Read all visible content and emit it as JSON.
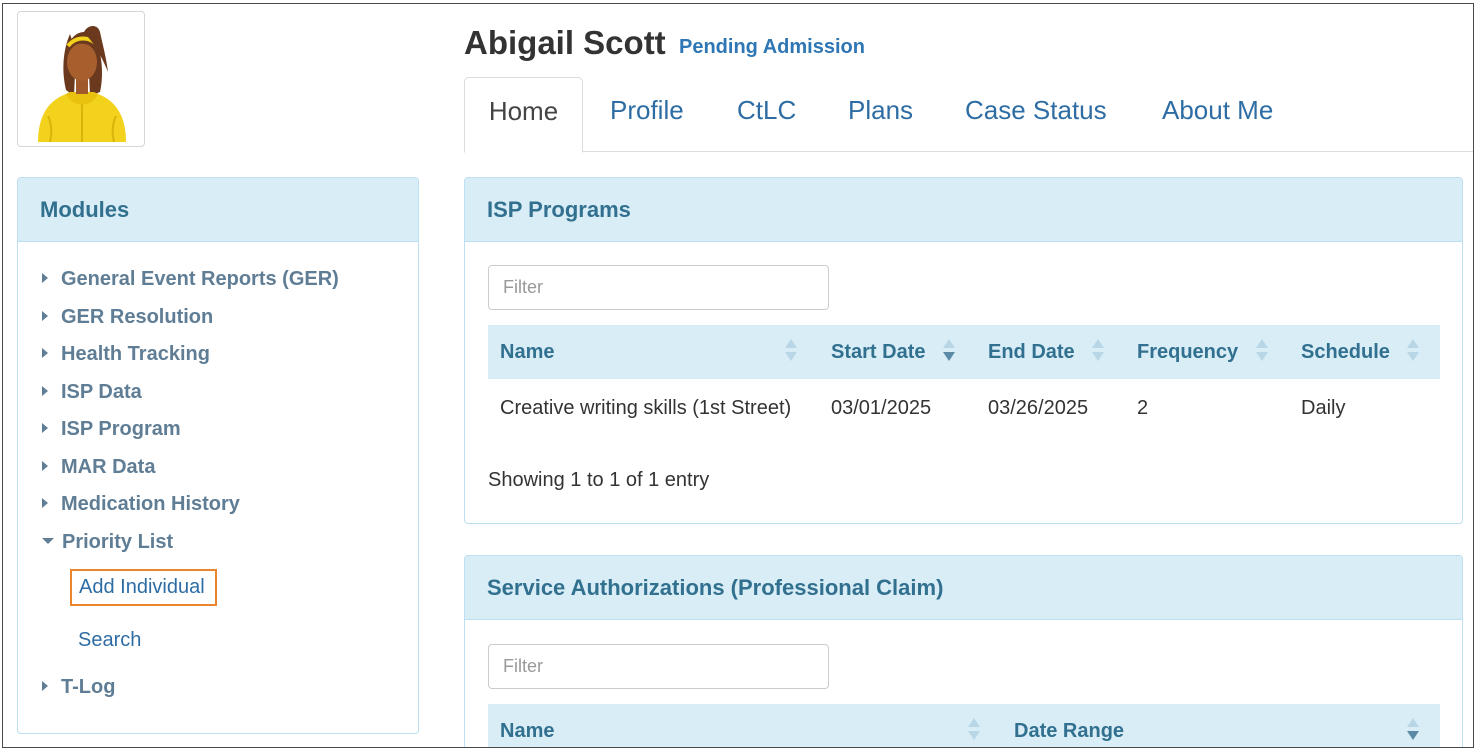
{
  "person": {
    "name": "Abigail Scott",
    "status": "Pending Admission",
    "avatar_icon": "avatar-person-icon"
  },
  "tabs": [
    {
      "label": "Home",
      "active": true
    },
    {
      "label": "Profile"
    },
    {
      "label": "CtLC"
    },
    {
      "label": "Plans"
    },
    {
      "label": "Case Status"
    },
    {
      "label": "About Me"
    }
  ],
  "modules": {
    "title": "Modules",
    "items": [
      {
        "label": "General Event Reports (GER)",
        "expanded": false
      },
      {
        "label": "GER Resolution",
        "expanded": false
      },
      {
        "label": "Health Tracking",
        "expanded": false
      },
      {
        "label": "ISP Data",
        "expanded": false
      },
      {
        "label": "ISP Program",
        "expanded": false
      },
      {
        "label": "MAR Data",
        "expanded": false
      },
      {
        "label": "Medication History",
        "expanded": false
      },
      {
        "label": "Priority List",
        "expanded": true
      },
      {
        "label": "T-Log",
        "expanded": false
      }
    ],
    "priority_sub": [
      {
        "label": "Add Individual",
        "highlighted": true
      },
      {
        "label": "Search"
      }
    ]
  },
  "isp_programs": {
    "title": "ISP Programs",
    "filter_placeholder": "Filter",
    "columns": [
      "Name",
      "Start Date",
      "End Date",
      "Frequency",
      "Schedule"
    ],
    "rows": [
      [
        "Creative writing skills (1st Street)",
        "03/01/2025",
        "03/26/2025",
        "2",
        "Daily"
      ]
    ],
    "info": "Showing 1 to 1 of 1 entry"
  },
  "service_auth": {
    "title": "Service Authorizations (Professional Claim)",
    "filter_placeholder": "Filter",
    "columns": [
      "Name",
      "Date Range"
    ]
  },
  "colors": {
    "accent": "#2e6da4",
    "panel_heading_bg": "#d9edf7",
    "panel_heading_text": "#31708f",
    "highlight_border": "#e8852d"
  }
}
